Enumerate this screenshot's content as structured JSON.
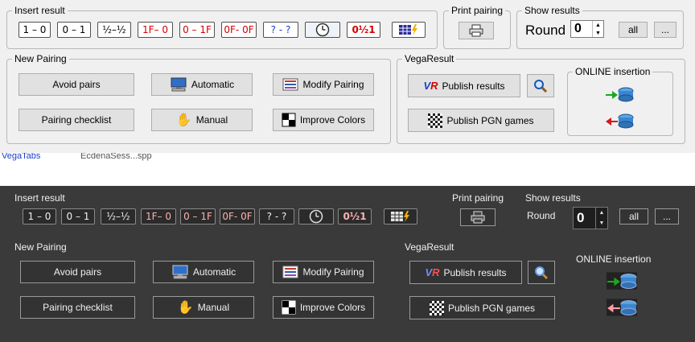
{
  "insert_result": {
    "label": "Insert result",
    "buttons": [
      "1 – 0",
      "0 – 1",
      "½–½",
      "1F– 0",
      "0 – 1F",
      "0F- 0F",
      "? - ?",
      "clock-icon",
      "0½1",
      "table-flash-icon"
    ]
  },
  "print_pairing": {
    "label": "Print pairing",
    "icon": "printer-icon"
  },
  "show_results": {
    "label": "Show results",
    "round_label": "Round",
    "round_value": "0",
    "all_label": "all",
    "more_label": "..."
  },
  "new_pairing": {
    "label": "New Pairing",
    "avoid_pairs": "Avoid pairs",
    "automatic": "Automatic",
    "modify_pairing": "Modify Pairing",
    "pairing_checklist": "Pairing checklist",
    "manual": "Manual",
    "improve_colors": "Improve Colors"
  },
  "vega_result": {
    "label": "VegaResult",
    "publish_results": "Publish results",
    "publish_pgn": "Publish PGN games",
    "search_icon": "magnifier-icon"
  },
  "online_insertion": {
    "label": "ONLINE insertion",
    "upload_icon": "upload-db-icon",
    "download_icon": "download-db-icon"
  },
  "background_strip": {
    "text_left": "VegaTabs",
    "text_mid": "EcdenaSess...spp"
  },
  "colors": {
    "red_text": "#d40000",
    "blue_text": "#1a3fcc",
    "dark_bg": "#3a3a3a",
    "light_bg": "#f0f0f0"
  }
}
